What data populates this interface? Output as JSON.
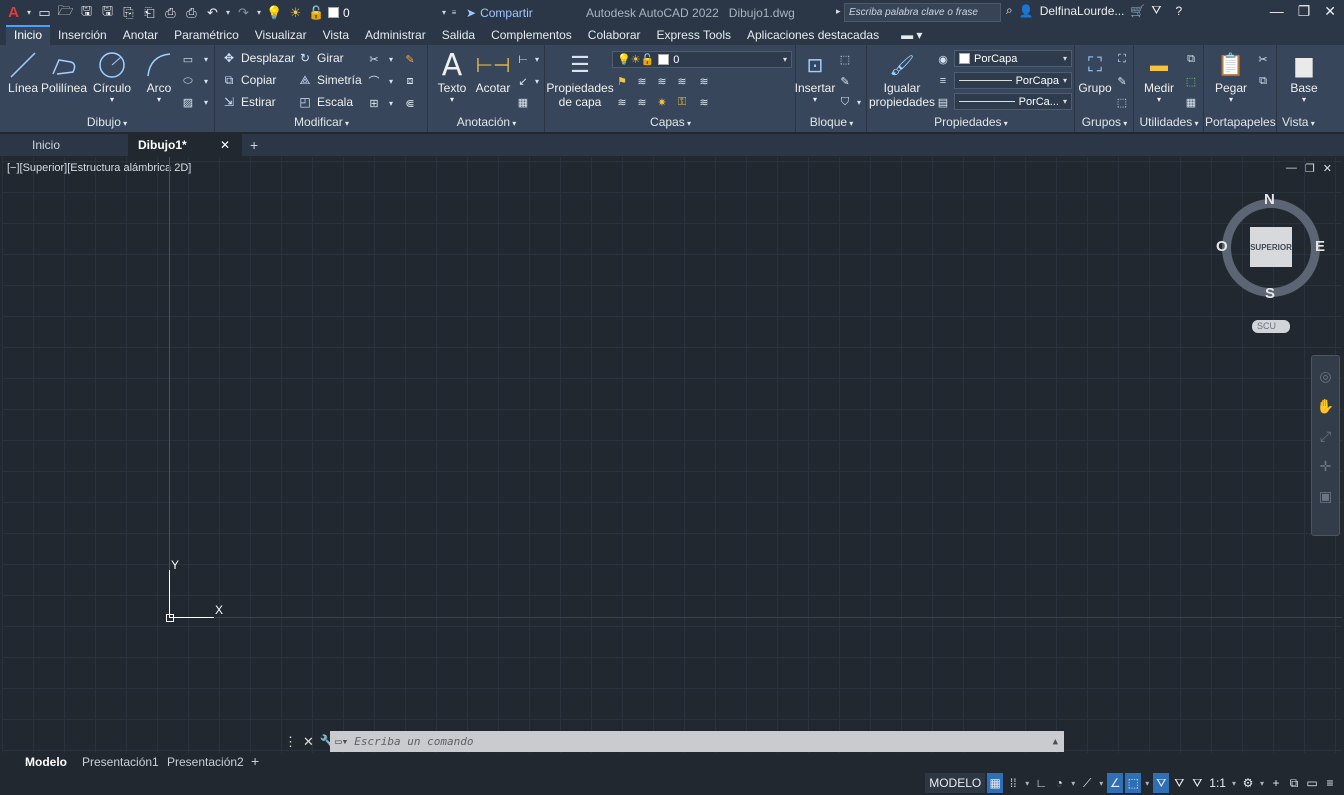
{
  "titlebar": {
    "layer_name": "0",
    "share_label": "Compartir",
    "app_title": "Autodesk AutoCAD 2022",
    "file_name": "Dibujo1.dwg",
    "search_placeholder": "Escriba palabra clave o frase",
    "user_name": "DelfinaLourde..."
  },
  "ribbon_tabs": [
    "Inicio",
    "Inserción",
    "Anotar",
    "Paramétrico",
    "Visualizar",
    "Vista",
    "Administrar",
    "Salida",
    "Complementos",
    "Colaborar",
    "Express Tools",
    "Aplicaciones destacadas"
  ],
  "panels": {
    "dibujo": {
      "title": "Dibujo",
      "linea": "Línea",
      "polilinea": "Polilínea",
      "circulo": "Círculo",
      "arco": "Arco"
    },
    "modificar": {
      "title": "Modificar",
      "desplazar": "Desplazar",
      "girar": "Girar",
      "copiar": "Copiar",
      "simetria": "Simetría",
      "estirar": "Estirar",
      "escala": "Escala"
    },
    "anotacion": {
      "title": "Anotación",
      "texto": "Texto",
      "acotar": "Acotar"
    },
    "capas": {
      "title": "Capas",
      "prop_line1": "Propiedades",
      "prop_line2": "de capa",
      "layer_value": "0"
    },
    "bloque": {
      "title": "Bloque",
      "insertar": "Insertar"
    },
    "propiedades": {
      "title": "Propiedades",
      "igualar_line1": "Igualar",
      "igualar_line2": "propiedades",
      "color": "PorCapa",
      "linetype": "PorCapa",
      "lineweight": "PorCa..."
    },
    "grupos": {
      "title": "Grupos",
      "grupo": "Grupo"
    },
    "utilidades": {
      "title": "Utilidades",
      "medir": "Medir"
    },
    "portapapeles": {
      "title": "Portapapeles",
      "pegar": "Pegar"
    },
    "vista": {
      "title": "Vista",
      "base": "Base"
    }
  },
  "doc_tabs": {
    "home": "Inicio",
    "active": "Dibujo1*"
  },
  "viewport": {
    "label": "[−][Superior][Estructura alámbrica 2D]",
    "ucs_y": "Y",
    "ucs_x": "X",
    "viewcube_face": "SUPERIOR",
    "compass": {
      "n": "N",
      "s": "S",
      "e": "E",
      "o": "O"
    },
    "scu": "SCU"
  },
  "command": {
    "placeholder": "Escriba un comando"
  },
  "layout_tabs": [
    "Modelo",
    "Presentación1",
    "Presentación2"
  ],
  "status": {
    "model": "MODELO",
    "scale": "1:1"
  },
  "colors": {
    "accent": "#2f6fb6",
    "background": "#212830",
    "ribbon": "#37465a",
    "titlebar": "#2b3646"
  }
}
